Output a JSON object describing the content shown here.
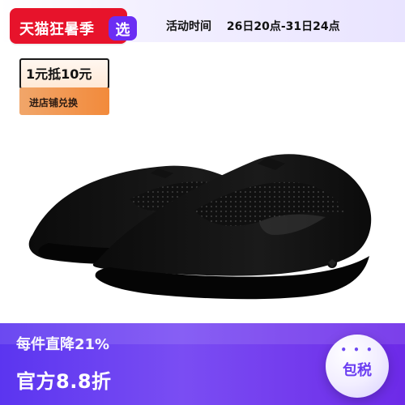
{
  "topbar": {
    "brand_main": "天猫狂暑季",
    "brand_select": "选",
    "event_label": "活动时间",
    "event_range": "26日20点-31日24点"
  },
  "coupon": {
    "amount_text": "1元抵10元",
    "action_text": "进店铺兑换"
  },
  "banner": {
    "line1": "每件直降21%",
    "line2": "官方8.8折"
  },
  "badge": {
    "dots": "• • •",
    "text": "包税"
  },
  "colors": {
    "tmall_red": "#e7132b",
    "select_purple": "#6b2df4",
    "banner_purple": "#6d2ae8",
    "coupon_orange": "#f28a3b"
  },
  "product": {
    "image": "black-slip-on-knit-shoes"
  }
}
